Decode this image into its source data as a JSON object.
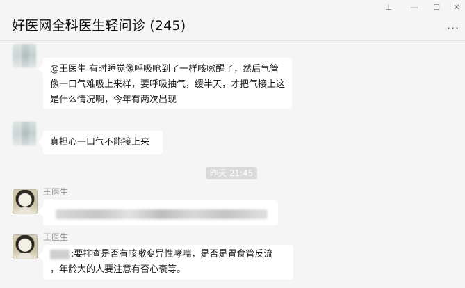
{
  "window": {
    "title": "好医网全科医生轻问诊 (245)",
    "controls": {
      "pin": "⊥",
      "minimize": "—",
      "maximize": "☐",
      "close": "✕"
    },
    "more": "···"
  },
  "messages": [
    {
      "text": "@王医生 有时睡觉像呼吸呛到了一样咳嗽醒了，然后气管像一口气难吸上来样，要呼吸抽气，缓半天，才把气接上这是什么情况啊，今年有两次出现"
    },
    {
      "text": "真担心一口气不能接上来"
    },
    {
      "sender": "王医生"
    },
    {
      "sender": "王医生",
      "line1": ":要排查是否有咳嗽变异性哮喘，是否是胃食管反流",
      "line2": "，年龄大的人要注意有否心衰等。"
    }
  ],
  "timestamp": "昨天 21:45"
}
